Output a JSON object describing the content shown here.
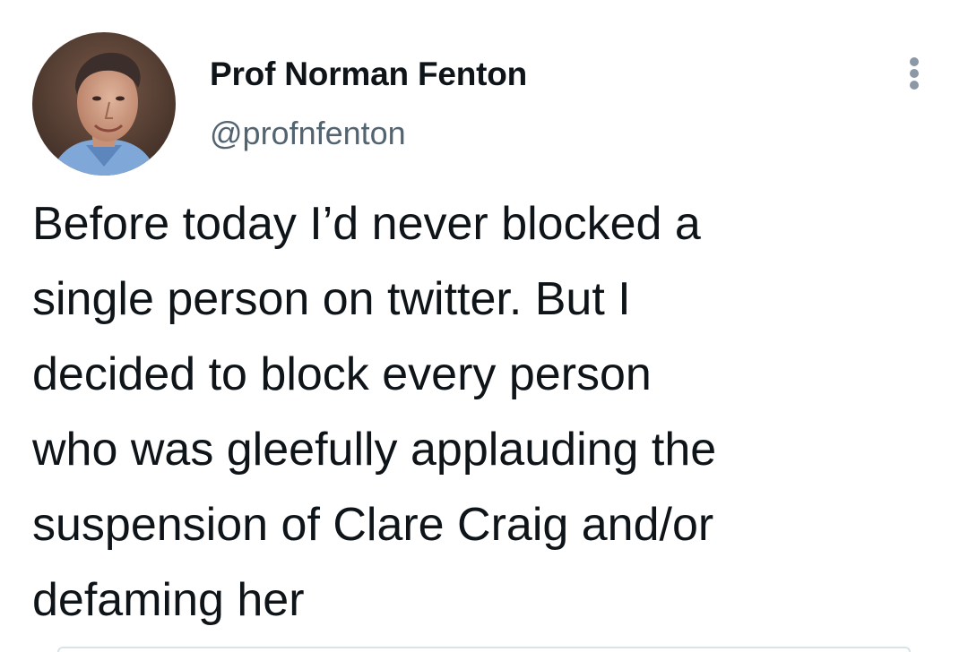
{
  "author": {
    "display_name": "Prof Norman Fenton",
    "handle": "@profnfenton"
  },
  "tweet": {
    "lines": [
      "Before today I’d never blocked a",
      "single person on twitter. But I",
      "decided to block every person",
      "who was gleefully applauding the",
      "suspension of Clare Craig and/or",
      "defaming her"
    ]
  },
  "icons": {
    "more": "more-options-icon"
  },
  "colors": {
    "text_primary": "#0f1419",
    "text_secondary": "#536471",
    "icon_gray": "#8b98a5"
  }
}
